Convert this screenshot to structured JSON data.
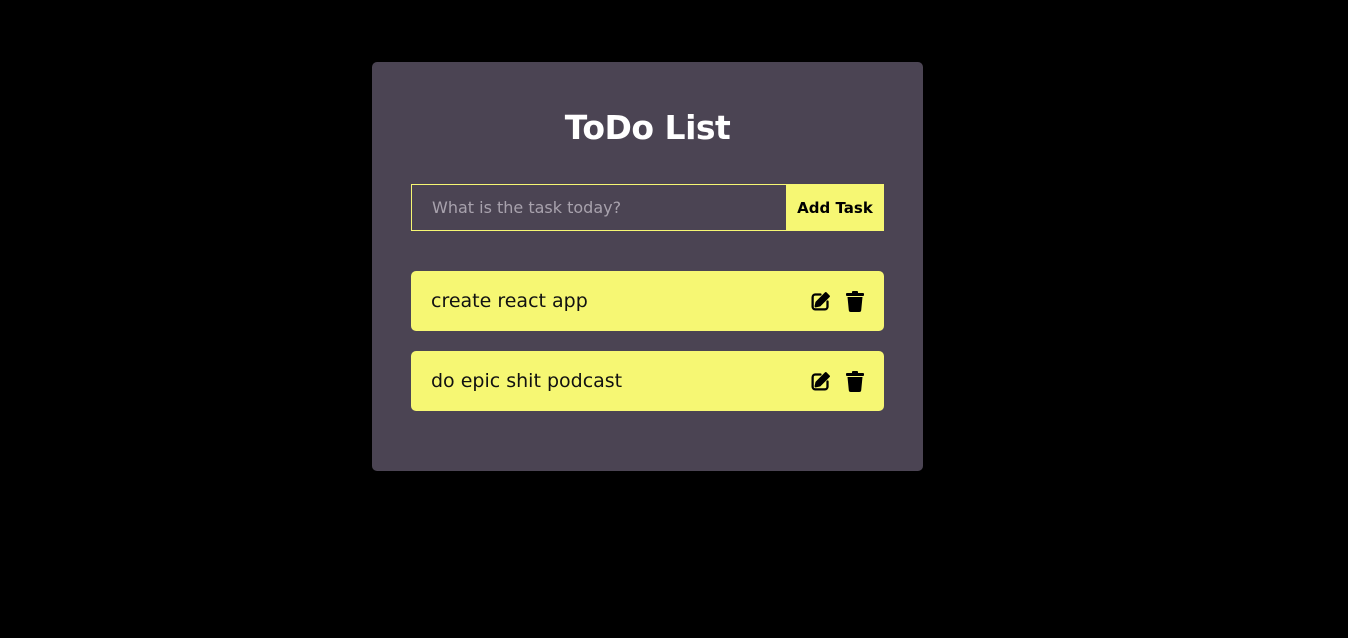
{
  "app": {
    "title": "ToDo List"
  },
  "form": {
    "placeholder": "What is the task today?",
    "value": "",
    "add_label": "Add Task"
  },
  "todos": [
    {
      "text": "create react app",
      "edit_icon": "edit-icon",
      "delete_icon": "trash-icon"
    },
    {
      "text": "do epic shit podcast",
      "edit_icon": "edit-icon",
      "delete_icon": "trash-icon"
    }
  ],
  "colors": {
    "background": "#000000",
    "card": "#4b4453",
    "accent": "#f6f773",
    "title": "#ffffff",
    "item_text": "#111111"
  }
}
